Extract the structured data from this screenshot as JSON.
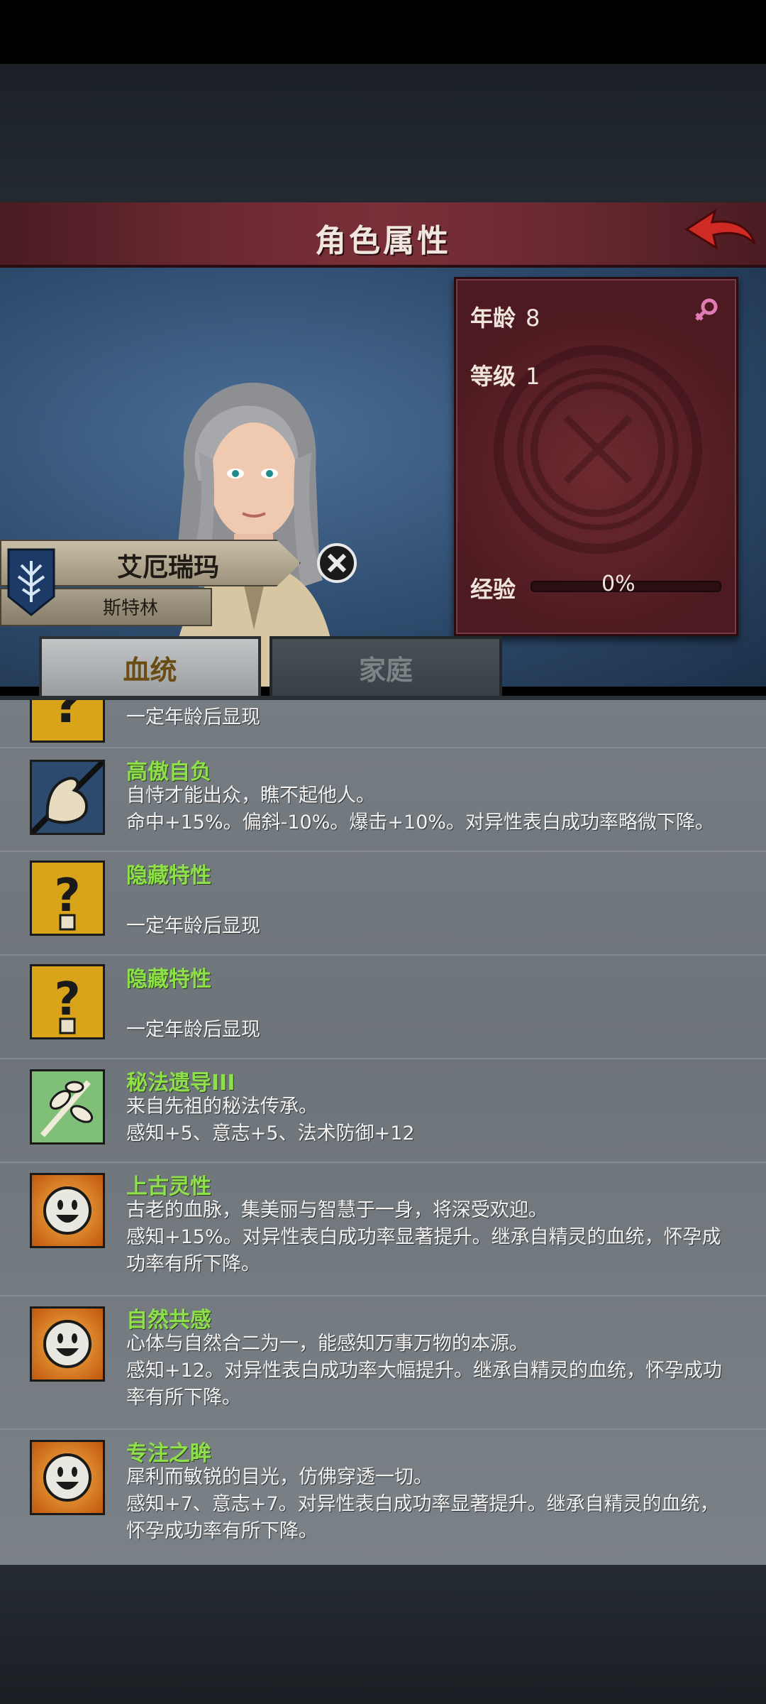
{
  "header": {
    "title": "角色属性"
  },
  "stats": {
    "age_label": "年龄",
    "age": "8",
    "level_label": "等级",
    "level": "1",
    "exp_label": "经验",
    "exp": "0%"
  },
  "character": {
    "name": "艾厄瑞玛",
    "house": "斯特林"
  },
  "tabs": [
    {
      "label": "血统",
      "active": true
    },
    {
      "label": "家庭",
      "active": false
    }
  ],
  "traits": [
    {
      "name": "",
      "lines": [
        "一定年龄后显现"
      ],
      "icon": "question-icon"
    },
    {
      "name": "高傲自负",
      "lines": [
        "自恃才能出众，瞧不起他人。",
        "命中+15%。偏斜-10%。爆击+10%。对异性表白成功率略微下降。"
      ],
      "icon": "flex-arm-icon"
    },
    {
      "name": "隐藏特性",
      "lines": [
        "",
        "一定年龄后显现"
      ],
      "icon": "question-icon"
    },
    {
      "name": "隐藏特性",
      "lines": [
        "",
        "一定年龄后显现"
      ],
      "icon": "question-icon"
    },
    {
      "name": "秘法遗导III",
      "lines": [
        "来自先祖的秘法传承。",
        "感知+5、意志+5、法术防御+12"
      ],
      "icon": "herb-branch-icon"
    },
    {
      "name": "上古灵性",
      "lines": [
        "古老的血脉，集美丽与智慧于一身，将深受欢迎。",
        "感知+15%。对异性表白成功率显著提升。继承自精灵的血统，怀孕成",
        "功率有所下降。"
      ],
      "icon": "sun-face-icon"
    },
    {
      "name": "自然共感",
      "lines": [
        "心体与自然合二为一，能感知万事万物的本源。",
        "感知+12。对异性表白成功率大幅提升。继承自精灵的血统，怀孕成功",
        "率有所下降。"
      ],
      "icon": "sun-face-icon"
    },
    {
      "name": "专注之眸",
      "lines": [
        "犀利而敏锐的目光，仿佛穿透一切。",
        "感知+7、意志+7。对异性表白成功率显著提升。继承自精灵的血统，",
        "怀孕成功率有所下降。"
      ],
      "icon": "sun-face-icon"
    }
  ]
}
